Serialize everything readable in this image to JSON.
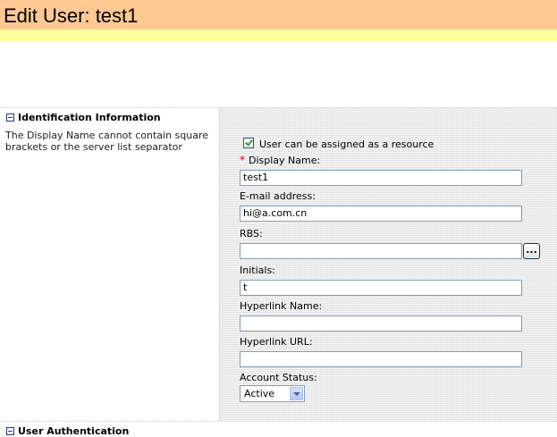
{
  "page": {
    "title": "Edit User: test1"
  },
  "identification": {
    "heading": "Identification Information",
    "description": "The Display Name cannot contain square brackets or the server list separator",
    "resource_checkbox": {
      "label": "User can be assigned as a resource",
      "checked": true
    },
    "display_name": {
      "required_mark": "*",
      "label": "Display Name:",
      "value": "test1"
    },
    "email": {
      "label": "E-mail address:",
      "value": "hi@a.com.cn"
    },
    "rbs": {
      "label": "RBS:",
      "value": "",
      "browse_label": "..."
    },
    "initials": {
      "label": "Initials:",
      "value": "t"
    },
    "hyperlink_name": {
      "label": "Hyperlink Name:",
      "value": ""
    },
    "hyperlink_url": {
      "label": "Hyperlink URL:",
      "value": ""
    },
    "account_status": {
      "label": "Account Status:",
      "selected": "Active"
    }
  },
  "next_section": {
    "heading": "User Authentication"
  },
  "colors": {
    "title_bar": "#fdc892",
    "yellow_band": "#fffe9c",
    "panel": "#ebebeb",
    "input_border": "#7f9db9",
    "required": "#d20000"
  }
}
